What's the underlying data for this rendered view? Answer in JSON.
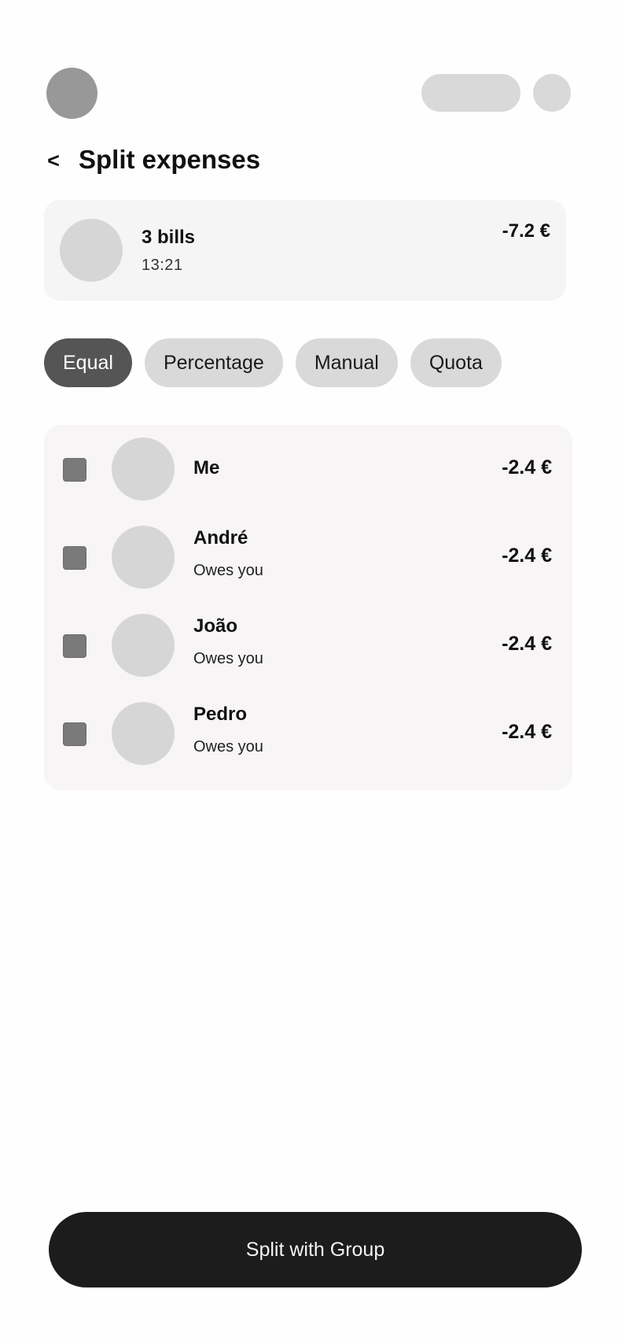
{
  "header": {
    "back_label": "<",
    "title": "Split expenses"
  },
  "summary": {
    "title": "3 bills",
    "time": "13:21",
    "amount": "-7.2 €"
  },
  "tabs": [
    {
      "label": "Equal",
      "active": true
    },
    {
      "label": "Percentage",
      "active": false
    },
    {
      "label": "Manual",
      "active": false
    },
    {
      "label": "Quota",
      "active": false
    }
  ],
  "members": [
    {
      "name": "Me",
      "status": "",
      "amount": "-2.4 €"
    },
    {
      "name": "André",
      "status": "Owes you",
      "amount": "-2.4 €"
    },
    {
      "name": "João",
      "status": "Owes you",
      "amount": "-2.4 €"
    },
    {
      "name": "Pedro",
      "status": "Owes you",
      "amount": "-2.4 €"
    }
  ],
  "footer": {
    "split_button_label": "Split with Group"
  },
  "colors": {
    "active_tab": "#555555",
    "inactive_tab": "#d9d9d9",
    "primary_button": "#1c1c1c",
    "checkbox": "#7a7a7a"
  }
}
